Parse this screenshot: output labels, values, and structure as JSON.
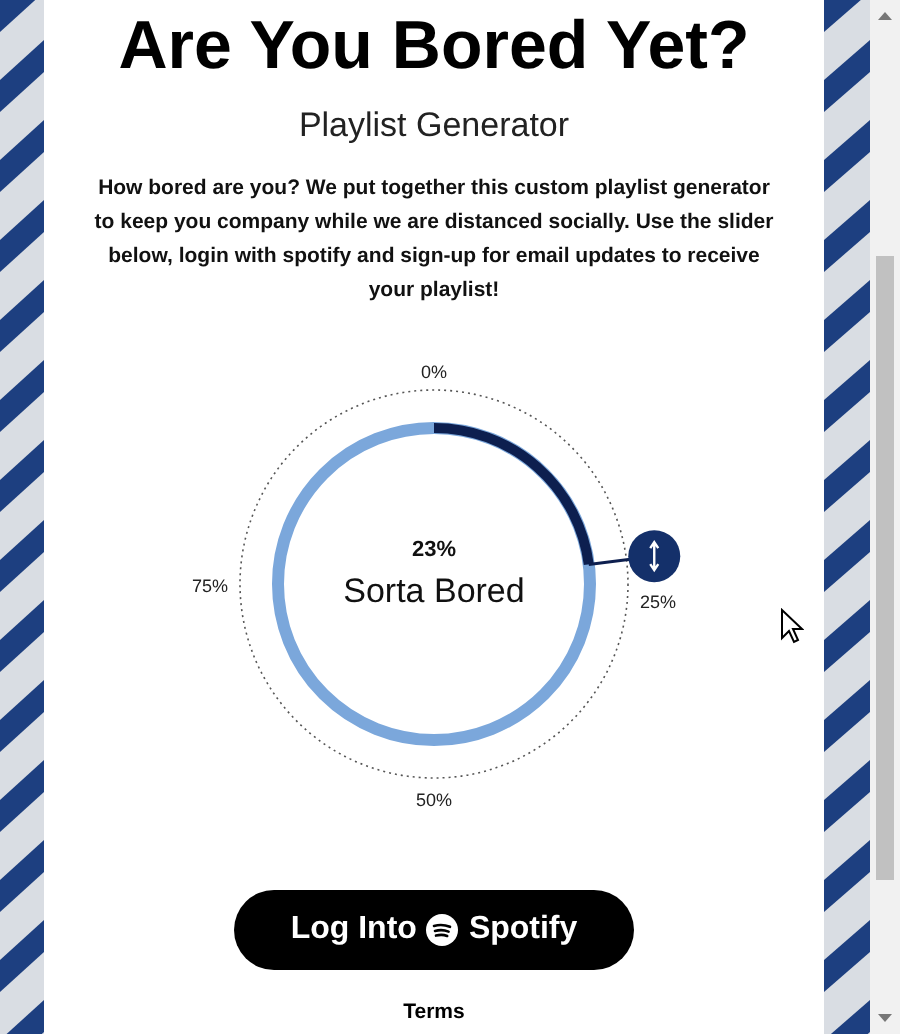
{
  "header": {
    "title": "Are You Bored Yet?",
    "subtitle": "Playlist Generator"
  },
  "intro": "How bored are you? We put together this custom playlist generator to keep you company while we are distanced socially. Use the slider below, login with spotify and sign-up for email updates to receive your playlist!",
  "slider": {
    "reading": "23%",
    "mood": "Sorta Bored",
    "ticks": [
      "0%",
      "25%",
      "50%",
      "75%"
    ]
  },
  "login_button": {
    "label_before": "Log Into",
    "label_after": "Spotify"
  },
  "footer_link": "Terms"
}
